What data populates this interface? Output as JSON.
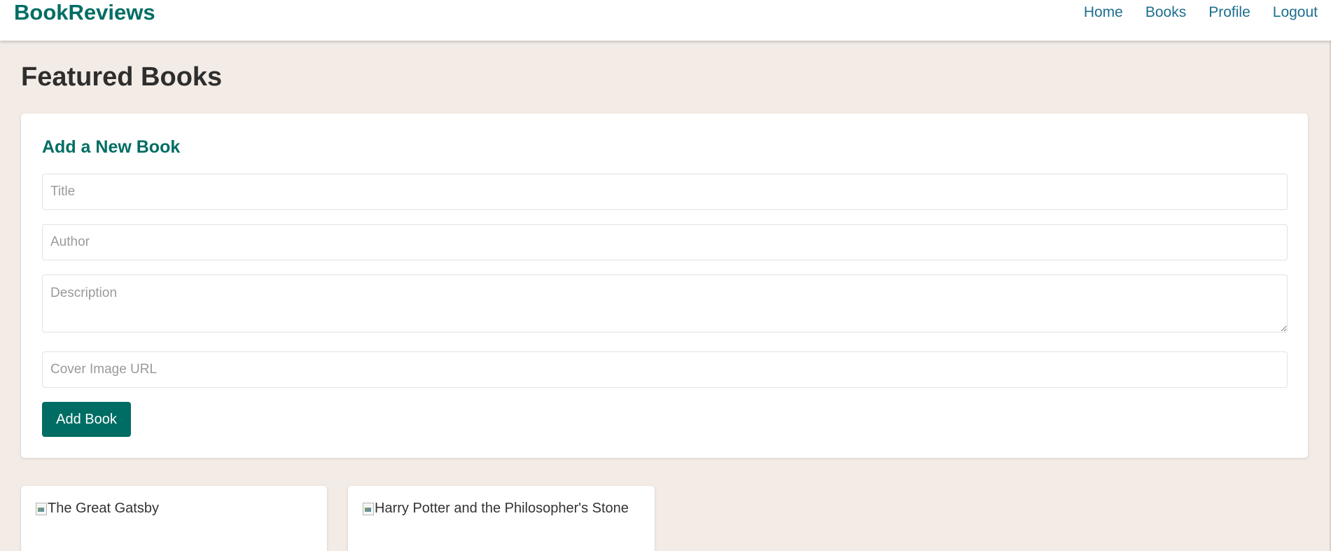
{
  "navbar": {
    "brand": "BookReviews",
    "links": [
      "Home",
      "Books",
      "Profile",
      "Logout"
    ]
  },
  "main": {
    "title": "Featured Books"
  },
  "form": {
    "heading": "Add a New Book",
    "title_placeholder": "Title",
    "author_placeholder": "Author",
    "description_placeholder": "Description",
    "cover_placeholder": "Cover Image URL",
    "submit_label": "Add Book"
  },
  "books": [
    {
      "title": "The Great Gatsby",
      "cover_alt": "The Great Gatsby"
    },
    {
      "title": "Harry Potter and the Philosopher's Stone",
      "cover_alt": "Harry Potter and the Philosopher's Stone"
    }
  ],
  "colors": {
    "brand": "#006d64",
    "link": "#1d6f8e",
    "background": "#f3ebe5"
  }
}
